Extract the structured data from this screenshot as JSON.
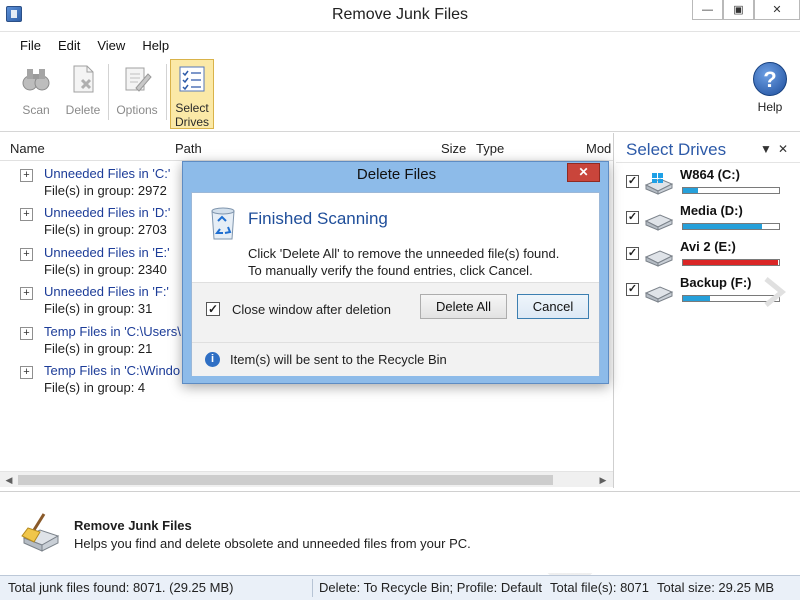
{
  "window": {
    "title": "Remove Junk Files",
    "minimize_icon": "minimize-icon",
    "maximize_icon": "maximize-icon",
    "close_icon": "close-icon"
  },
  "menu": [
    {
      "label": "File"
    },
    {
      "label": "Edit"
    },
    {
      "label": "View"
    },
    {
      "label": "Help"
    }
  ],
  "toolbar": {
    "scan": {
      "label": "Scan",
      "icon": "binoculars-icon"
    },
    "delete": {
      "label": "Delete",
      "icon": "delete-file-icon"
    },
    "options": {
      "label": "Options",
      "icon": "options-icon"
    },
    "select_drives": {
      "label_line1": "Select",
      "label_line2": "Drives",
      "icon": "checklist-icon"
    },
    "help": {
      "label": "Help",
      "icon": "help-icon"
    }
  },
  "list": {
    "columns": {
      "name": "Name",
      "path": "Path",
      "size": "Size",
      "type": "Type",
      "mod": "Mod"
    },
    "groups": [
      {
        "title": "Unneeded Files in 'C:'",
        "count": "File(s) in group: 2972"
      },
      {
        "title": "Unneeded Files in 'D:'",
        "count": "File(s) in group: 2703"
      },
      {
        "title": "Unneeded Files in 'E:'",
        "count": "File(s) in group: 2340"
      },
      {
        "title": "Unneeded Files in 'F:'",
        "count": "File(s) in group: 31"
      },
      {
        "title": "Temp Files in 'C:\\Users\\",
        "count": "File(s) in group: 21"
      },
      {
        "title": "Temp Files in 'C:\\Windo",
        "count": "File(s) in group: 4"
      }
    ]
  },
  "drives_pane": {
    "title": "Select Drives",
    "drives": [
      {
        "name": "W864 (C:)",
        "checked": true,
        "icon": "windows-drive-icon",
        "usage": 0.16,
        "bar_color": "#26a0da"
      },
      {
        "name": "Media (D:)",
        "checked": true,
        "icon": "hard-drive-icon",
        "usage": 0.82,
        "bar_color": "#26a0da"
      },
      {
        "name": "Avi 2 (E:)",
        "checked": true,
        "icon": "hard-drive-icon",
        "usage": 0.99,
        "bar_color": "#da2626"
      },
      {
        "name": "Backup (F:)",
        "checked": true,
        "icon": "hard-drive-icon",
        "usage": 0.28,
        "bar_color": "#26a0da"
      }
    ]
  },
  "footer": {
    "title": "Remove Junk Files",
    "description": "Helps you find and delete obsolete and unneeded files from your PC.",
    "icon": "broom-icon"
  },
  "status": {
    "total_junk": "Total junk files found: 8071. (29.25 MB)",
    "delete_mode": "Delete: To Recycle Bin; Profile: Default",
    "total_files": "Total file(s): 8071",
    "total_size": "Total size: 29.25 MB"
  },
  "dialog": {
    "title": "Delete Files",
    "heading": "Finished Scanning",
    "line1": "Click 'Delete All' to remove the unneeded file(s) found.",
    "line2": "To manually verify the found entries, click Cancel.",
    "checkbox_label": "Close window after deletion",
    "checkbox_checked": true,
    "delete_all": "Delete All",
    "cancel": "Cancel",
    "info": "Item(s) will be sent to the Recycle Bin",
    "close_symbol": "✕"
  }
}
